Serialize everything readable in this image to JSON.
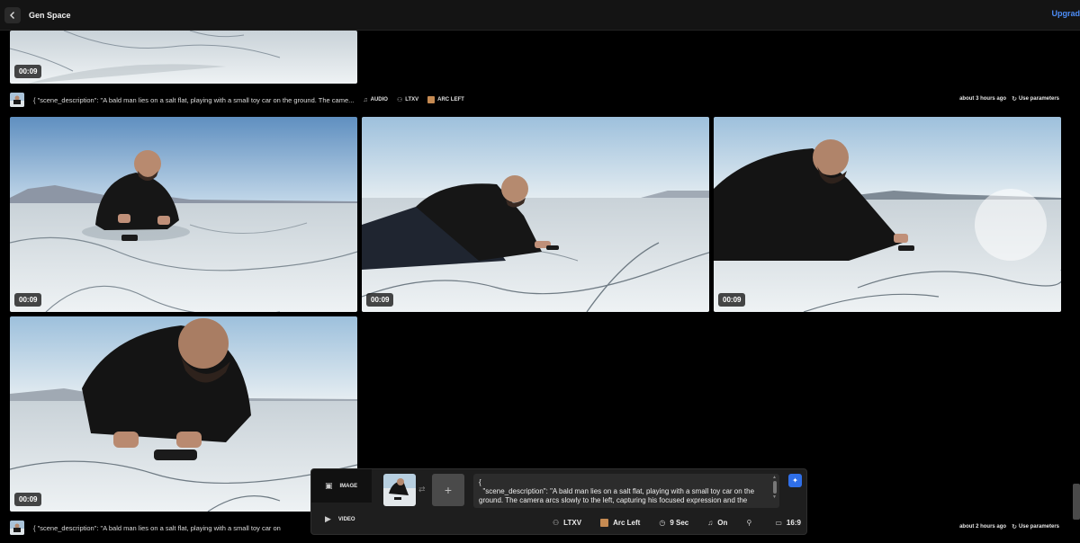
{
  "header": {
    "title": "Gen Space",
    "upgrade_label": "Upgrad"
  },
  "tiles": {
    "duration": "00:09"
  },
  "generations": [
    {
      "prompt": "{ \"scene_description\": \"A bald man lies on a salt flat, playing with a small toy car on the ground. The came...",
      "chips": [
        "AUDIO",
        "LTXV",
        "ARC LEFT"
      ],
      "time_ago": "about 3 hours ago",
      "use_params_label": "Use parameters"
    },
    {
      "prompt": "{ \"scene_description\": \"A bald man lies on a salt flat, playing with a small toy car on",
      "time_ago": "about 2 hours ago",
      "use_params_label": "Use parameters"
    }
  ],
  "composer": {
    "modes": [
      "IMAGE",
      "VIDEO"
    ],
    "prompt": "{\n  \"scene_description\": \"A bald man lies on a salt flat, playing with a small toy car on the ground. The camera arcs slowly to the left, capturing his focused expression and the",
    "settings": {
      "model": "LTXV",
      "camera": "Arc Left",
      "duration": "9 Sec",
      "audio": "On",
      "aspect": "16:9"
    }
  },
  "colors": {
    "accent": "#4d8df7",
    "enhance_button": "#2f6fe8",
    "background": "#000000"
  }
}
